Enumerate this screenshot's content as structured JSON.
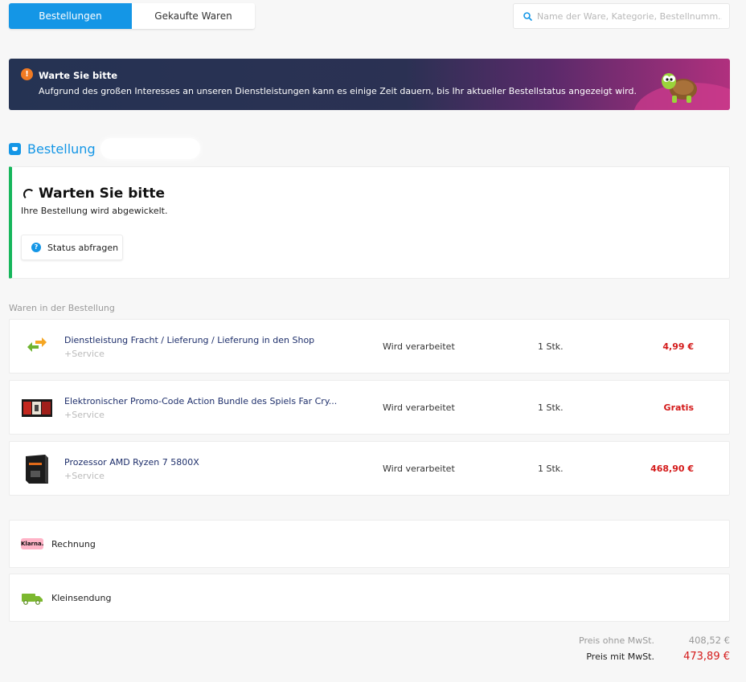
{
  "tabs": [
    {
      "label": "Bestellungen",
      "active": true
    },
    {
      "label": "Gekaufte Waren",
      "active": false
    }
  ],
  "search": {
    "placeholder": "Name der Ware, Kategorie, Bestellnumm..."
  },
  "banner": {
    "title": "Warte Sie bitte",
    "text": "Aufgrund des großen Interesses an unseren Dienstleistungen kann es einige Zeit dauern, bis Ihr aktueller Bestellstatus angezeigt wird."
  },
  "order": {
    "title": "Bestellung"
  },
  "status_card": {
    "title": "Warten Sie bitte",
    "subtitle": "Ihre Bestellung wird abgewickelt.",
    "button": "Status abfragen"
  },
  "items_label": "Waren in der Bestellung",
  "items": [
    {
      "name": "Dienstleistung Fracht / Lieferung / Lieferung in den Shop",
      "service": "+Service",
      "status": "Wird verarbeitet",
      "qty": "1 Stk.",
      "price": "4,99 €",
      "icon": "arrows-exchange-icon"
    },
    {
      "name": "Elektronischer Promo-Code Action Bundle des Spiels Far Cry...",
      "service": "+Service",
      "status": "Wird verarbeitet",
      "qty": "1 Stk.",
      "price": "Gratis",
      "icon": "game-cover-thumbnail"
    },
    {
      "name": "Prozessor AMD Ryzen 7 5800X",
      "service": "+Service",
      "status": "Wird verarbeitet",
      "qty": "1 Stk.",
      "price": "468,90 €",
      "icon": "cpu-box-thumbnail"
    }
  ],
  "payment": {
    "label": "Rechnung",
    "logo_text": "Klarna."
  },
  "shipping": {
    "label": "Kleinsendung",
    "icon": "delivery-truck-icon"
  },
  "totals": {
    "net_label": "Preis ohne MwSt.",
    "net_value": "408,52 €",
    "gross_label": "Preis mit MwSt.",
    "gross_value": "473,89 €"
  },
  "colors": {
    "accent": "#1496e6",
    "price": "#d41a1a",
    "success": "#17b65c",
    "warning": "#f07a23"
  }
}
